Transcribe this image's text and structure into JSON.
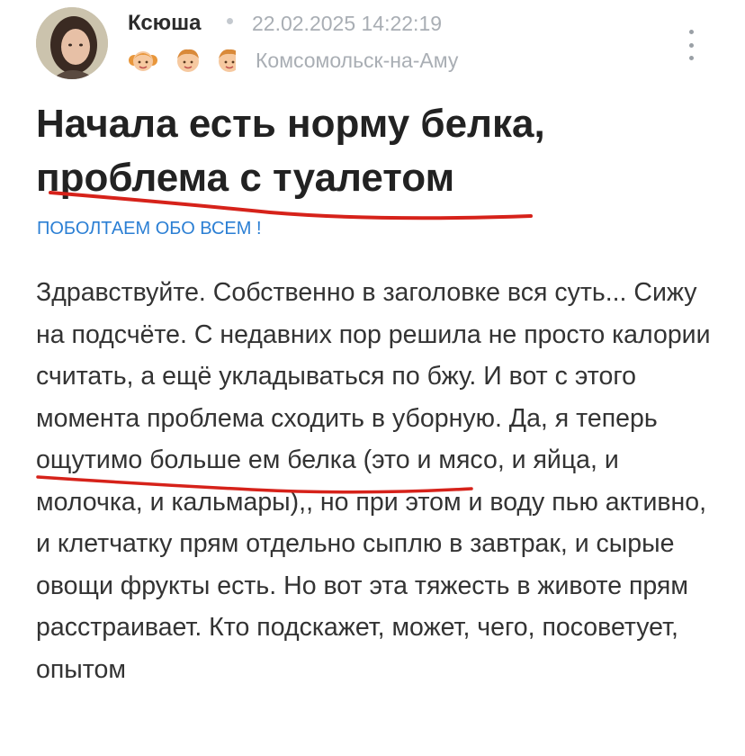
{
  "post": {
    "author": "Ксюша",
    "date": "22.02.2025 14:22:19",
    "city": "Комсомольск-на-Аму",
    "badges": [
      "girl-face-icon",
      "boy-face-icon",
      "boy-face-icon"
    ],
    "title": "Начала есть норму белка, проблема с туалетом",
    "category": "ПОБОЛТАЕМ ОБО ВСЕМ !",
    "body": "Здравствуйте. Собственно в заголовке вся суть... Сижу на подсчёте. С недавних пор решила не просто калории считать, а ещё укладываться по бжу. И вот с этого момента проблема сходить в уборную. Да, я теперь ощутимо больше ем белка (это и мясо, и яйца, и молочка, и кальмары),, но при этом и воду пью активно, и клетчатку прям отдельно сыплю в завтрак, и сырые овощи фрукты есть. Но вот эта тяжесть в животе прям расстраивает. Кто подскажет, может, чего, посоветует, опытом"
  },
  "menu_icon": "more-vertical-icon",
  "colors": {
    "title": "#222222",
    "link": "#2b7fd4",
    "meta": "#a9aeb4",
    "annotation": "#d6221a"
  }
}
